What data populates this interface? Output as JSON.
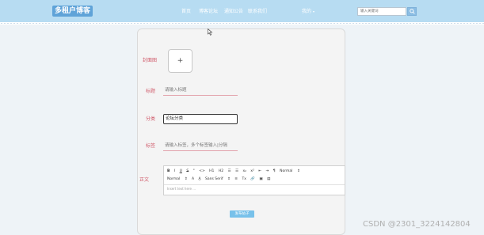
{
  "header": {
    "logo": "多租户博客",
    "nav": [
      "首页",
      "博客论坛",
      "通知公告",
      "联系我们"
    ],
    "mine": "我的",
    "mine_caret": "▾",
    "search_placeholder": "输入关键词"
  },
  "form": {
    "cover_label": "封面图",
    "upload_symbol": "+",
    "title_label": "标题",
    "title_placeholder": "请输入标题",
    "category_label": "分类",
    "category_value": "论坛分类",
    "tags_label": "标签",
    "tags_placeholder": "请输入标签，多个标签输入|分隔",
    "body_label": "正文",
    "editor": {
      "row1": [
        "B",
        "I",
        "U",
        "S",
        "\"",
        "<>",
        "H1",
        "H2",
        "☰",
        "☰",
        "x₂",
        "x²",
        "⇤",
        "⇥",
        "¶",
        "Normal",
        "⇕"
      ],
      "row2": [
        "Normal",
        "⇕",
        "A",
        "A̲",
        "Sans Serif",
        "⇕",
        "≡",
        "Tx",
        "🔗",
        "▣",
        "▤"
      ],
      "placeholder": "Insert text here ..."
    },
    "submit_label": "发布帖子"
  },
  "watermark": "CSDN @2301_3224142804",
  "colors": {
    "topbar": "#b7dcf2",
    "logo_bg": "#5fa3d8",
    "label": "#d05a6a",
    "submit": "#78c1ea"
  }
}
